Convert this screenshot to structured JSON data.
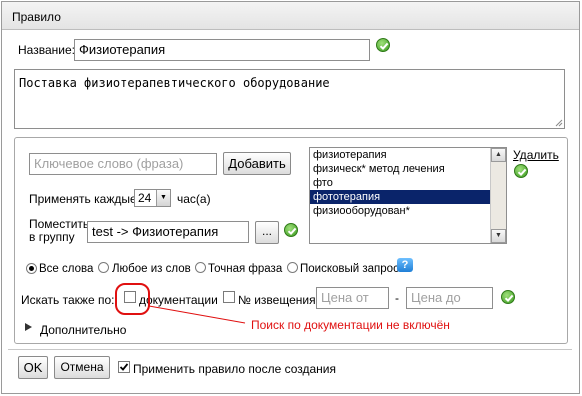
{
  "window": {
    "title": "Правило"
  },
  "name": {
    "label": "Название:",
    "value": "Физиотерапия"
  },
  "description": {
    "value": "Поставка физиотерапевтического оборудование"
  },
  "keyword": {
    "placeholder": "Ключевое слово (фраза)",
    "add_label": "Добавить"
  },
  "schedule": {
    "label": "Применять каждые",
    "value": "24",
    "unit": "час(а)"
  },
  "group": {
    "label_line1": "Поместить",
    "label_line2": "в группу",
    "value": "test -> Физиотерапия",
    "browse_label": "..."
  },
  "keywords_list": {
    "items": [
      "физиотерапия",
      "физическ* метод лечения",
      "фто",
      "фототерапия",
      "физиооборудован*"
    ],
    "selected_index": 3,
    "delete_label": "Удалить"
  },
  "match_mode": {
    "options": [
      "Все слова",
      "Любое из слов",
      "Точная фраза",
      "Поисковый запрос"
    ],
    "selected": 0,
    "help_icon": "?"
  },
  "search_also": {
    "label": "Искать также по:",
    "documents_label": "документации",
    "notice_label": "№ извещения",
    "price_from_placeholder": "Цена от",
    "separator": "-",
    "price_to_placeholder": "Цена до"
  },
  "annotation": {
    "text": "Поиск по документации не включён",
    "color": "#e01010"
  },
  "advanced": {
    "label": "Дополнительно"
  },
  "footer": {
    "ok_label": "OK",
    "cancel_label": "Отмена",
    "apply_label": "Применить правило после создания",
    "apply_checked": true
  },
  "colors": {
    "accent_ok": "#3a9a1f",
    "selection": "#0a246a",
    "annotation": "#e01010"
  }
}
